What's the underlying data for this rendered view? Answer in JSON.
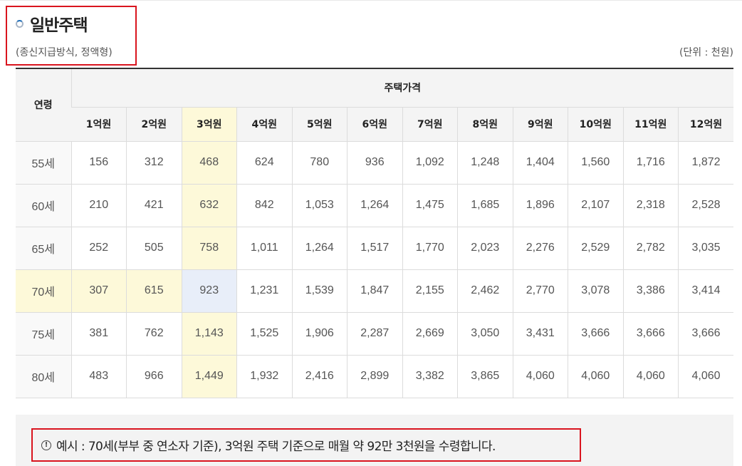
{
  "header": {
    "title": "일반주택",
    "subtitle": "(종신지급방식, 정액형)",
    "unit": "(단위 : 천원)"
  },
  "table": {
    "age_header": "연령",
    "price_header": "주택가격",
    "price_columns": [
      "1억원",
      "2억원",
      "3억원",
      "4억원",
      "5억원",
      "6억원",
      "7억원",
      "8억원",
      "9억원",
      "10억원",
      "11억원",
      "12억원"
    ],
    "rows": [
      {
        "age": "55세",
        "values": [
          "156",
          "312",
          "468",
          "624",
          "780",
          "936",
          "1,092",
          "1,248",
          "1,404",
          "1,560",
          "1,716",
          "1,872"
        ]
      },
      {
        "age": "60세",
        "values": [
          "210",
          "421",
          "632",
          "842",
          "1,053",
          "1,264",
          "1,475",
          "1,685",
          "1,896",
          "2,107",
          "2,318",
          "2,528"
        ]
      },
      {
        "age": "65세",
        "values": [
          "252",
          "505",
          "758",
          "1,011",
          "1,264",
          "1,517",
          "1,770",
          "2,023",
          "2,276",
          "2,529",
          "2,782",
          "3,035"
        ]
      },
      {
        "age": "70세",
        "values": [
          "307",
          "615",
          "923",
          "1,231",
          "1,539",
          "1,847",
          "2,155",
          "2,462",
          "2,770",
          "3,078",
          "3,386",
          "3,414"
        ]
      },
      {
        "age": "75세",
        "values": [
          "381",
          "762",
          "1,143",
          "1,525",
          "1,906",
          "2,287",
          "2,669",
          "3,050",
          "3,431",
          "3,666",
          "3,666",
          "3,666"
        ]
      },
      {
        "age": "80세",
        "values": [
          "483",
          "966",
          "1,449",
          "1,932",
          "2,416",
          "2,899",
          "3,382",
          "3,865",
          "4,060",
          "4,060",
          "4,060",
          "4,060"
        ]
      }
    ]
  },
  "note": {
    "icon": "info-icon",
    "text": "예시 : 70세(부부 중 연소자 기준), 3억원 주택 기준으로 매월 약 92만 3천원을 수령합니다."
  },
  "colors": {
    "highlight_border": "#d9141e",
    "highlight_column": "#fdf9d9",
    "highlight_cell": "#e8eef9"
  }
}
